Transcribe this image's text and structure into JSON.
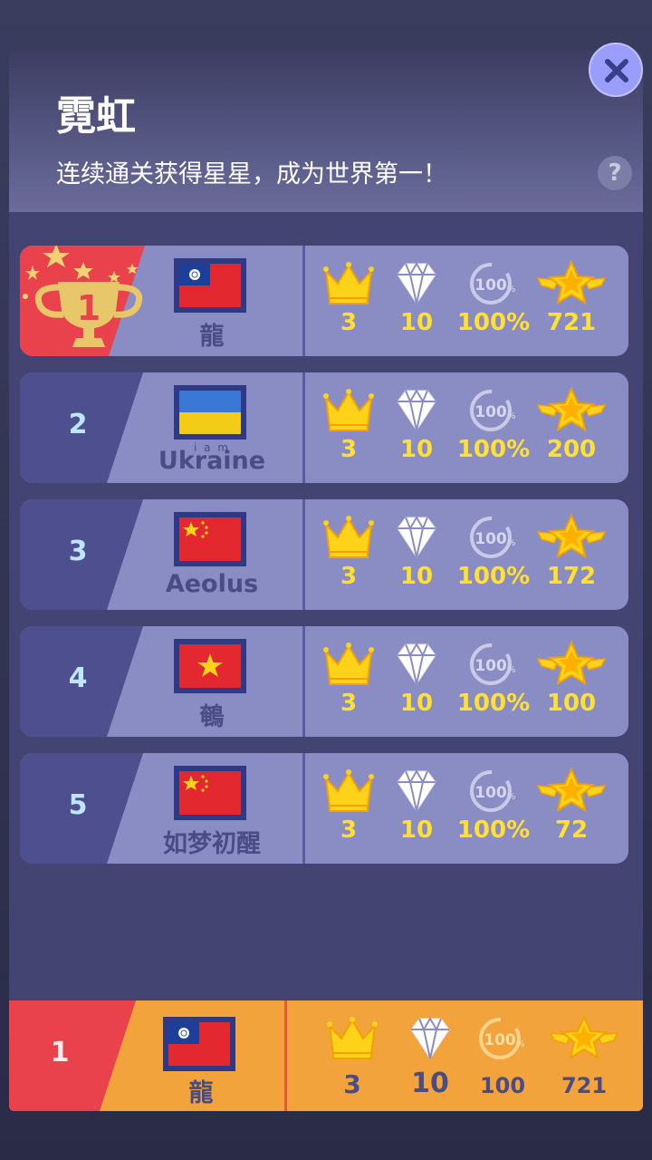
{
  "header": {
    "title": "霓虹",
    "subtitle": "连续通关获得星星，成为世界第一！",
    "help_label": "?"
  },
  "icons": {
    "close": "close-icon",
    "crown": "crown-icon",
    "diamond": "diamond-icon",
    "percent": "percent-badge-icon",
    "star": "winged-star-icon",
    "trophy": "trophy-icon"
  },
  "colors": {
    "panel": "#434471",
    "row": "#8a8cc4",
    "rank_cell": "#4d4f8e",
    "first_place": "#e9424c",
    "stat_value": "#ffe033",
    "my_row": "#f2a33b"
  },
  "leaderboard": [
    {
      "rank": "1",
      "name": "龍",
      "flag": "flag-taiwan",
      "crowns": "3",
      "diamonds": "10",
      "percent": "100%",
      "stars": "721"
    },
    {
      "rank": "2",
      "name": "Ukraine",
      "name_overlay": "i a m",
      "flag": "flag-ukraine",
      "crowns": "3",
      "diamonds": "10",
      "percent": "100%",
      "stars": "200"
    },
    {
      "rank": "3",
      "name": "Aeolus",
      "flag": "flag-china",
      "crowns": "3",
      "diamonds": "10",
      "percent": "100%",
      "stars": "172"
    },
    {
      "rank": "4",
      "name": "鵪",
      "flag": "flag-vietnam",
      "crowns": "3",
      "diamonds": "10",
      "percent": "100%",
      "stars": "100"
    },
    {
      "rank": "5",
      "name": "如梦初醒",
      "flag": "flag-china",
      "crowns": "3",
      "diamonds": "10",
      "percent": "100%",
      "stars": "72"
    }
  ],
  "my_rank": {
    "rank": "1",
    "name": "龍",
    "flag": "flag-taiwan",
    "crowns": "3",
    "diamonds": "10",
    "percent": "100",
    "stars": "721"
  }
}
